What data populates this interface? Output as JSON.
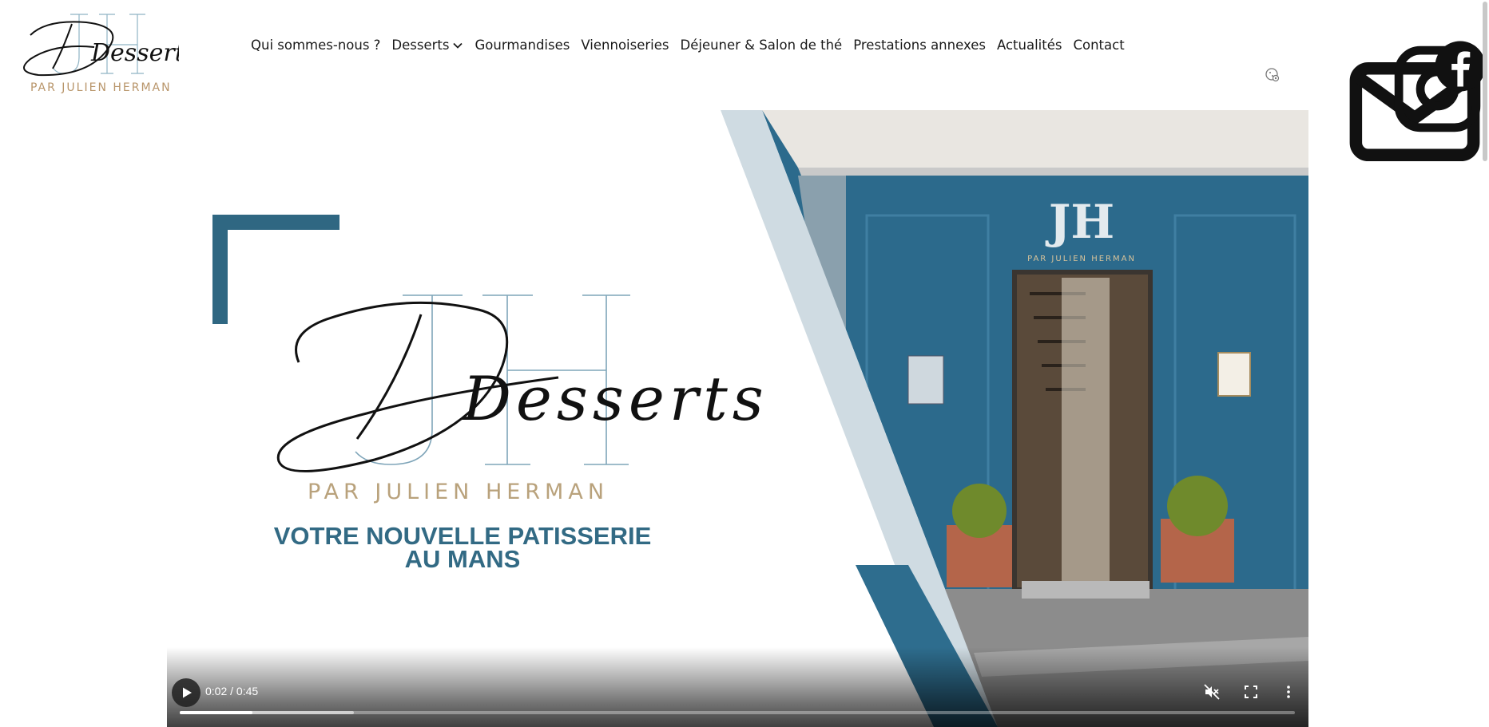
{
  "header": {
    "logo": {
      "monogram": "JH",
      "script": "Desserts",
      "subtitle": "PAR JULIEN HERMAN"
    },
    "nav": [
      {
        "label": "Qui sommes-nous ?",
        "has_dropdown": false
      },
      {
        "label": "Desserts",
        "has_dropdown": true
      },
      {
        "label": "Gourmandises",
        "has_dropdown": false
      },
      {
        "label": "Viennoiseries",
        "has_dropdown": false
      },
      {
        "label": "Déjeuner & Salon de thé",
        "has_dropdown": false
      },
      {
        "label": "Prestations annexes",
        "has_dropdown": false
      },
      {
        "label": "Actualités",
        "has_dropdown": false
      },
      {
        "label": "Contact",
        "has_dropdown": false
      }
    ],
    "social_icons": [
      "mail-icon",
      "instagram-icon",
      "facebook-icon"
    ],
    "cookie_icon": "cookie-settings-icon"
  },
  "video": {
    "logo_script": "Desserts",
    "logo_monogram": "JH",
    "subtitle": "PAR JULIEN HERMAN",
    "tagline_line1": "VOTRE NOUVELLE PATISSERIE",
    "tagline_line2": "AU MANS",
    "storefront_sign": "PAR JULIEN HERMAN",
    "time": "0:02 / 0:45",
    "progress_played": 0.065,
    "progress_buffered": 0.156,
    "controls": [
      "play-icon",
      "muted-icon",
      "fullscreen-icon",
      "more-options-icon"
    ]
  },
  "colors": {
    "brand_blue": "#326a84",
    "gold": "#b8956a",
    "storefront_blue": "#2e6d8e",
    "text_dark": "#1a1a1a"
  }
}
